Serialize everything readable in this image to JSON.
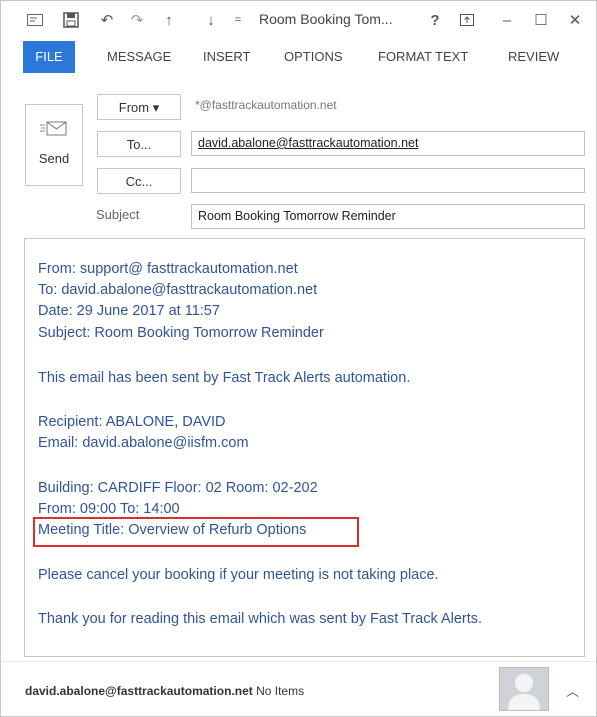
{
  "window": {
    "title": "Room Booking Tom...",
    "controls": {
      "help": "?",
      "minimize": "–",
      "maximize": "☐",
      "close": "✕"
    }
  },
  "ribbon": {
    "tabs": [
      "FILE",
      "MESSAGE",
      "INSERT",
      "OPTIONS",
      "FORMAT TEXT",
      "REVIEW"
    ],
    "active_tab": "FILE",
    "accent_color": "#2b78d8"
  },
  "header": {
    "send_label": "Send",
    "from_label": "From ▾",
    "from_value": "*@fasttrackautomation.net",
    "to_label": "To...",
    "to_value": "david.abalone@fasttrackautomation.net",
    "cc_label": "Cc...",
    "cc_value": "",
    "subject_label": "Subject",
    "subject_value": "Room Booking Tomorrow Reminder"
  },
  "body": {
    "text_color": "#2f5597",
    "lines": [
      "From: support@ fasttrackautomation.net",
      "To: david.abalone@fasttrackautomation.net",
      "Date: 29 June 2017 at 11:57",
      "Subject: Room Booking Tomorrow Reminder",
      "This email has been sent by Fast Track Alerts automation.",
      "Recipient: ABALONE, DAVID",
      "Email: david.abalone@iisfm.com",
      "Building: CARDIFF Floor: 02 Room: 02-202",
      "From: 09:00 To: 14:00",
      "Meeting Title: Overview of Refurb Options",
      "Please cancel your booking if your meeting is not taking place.",
      "Thank you for reading this email which was sent by Fast Track Alerts."
    ],
    "highlight_color": "#d92e2e"
  },
  "footer": {
    "email": "david.abalone@fasttrackautomation.net",
    "status": "No Items"
  }
}
